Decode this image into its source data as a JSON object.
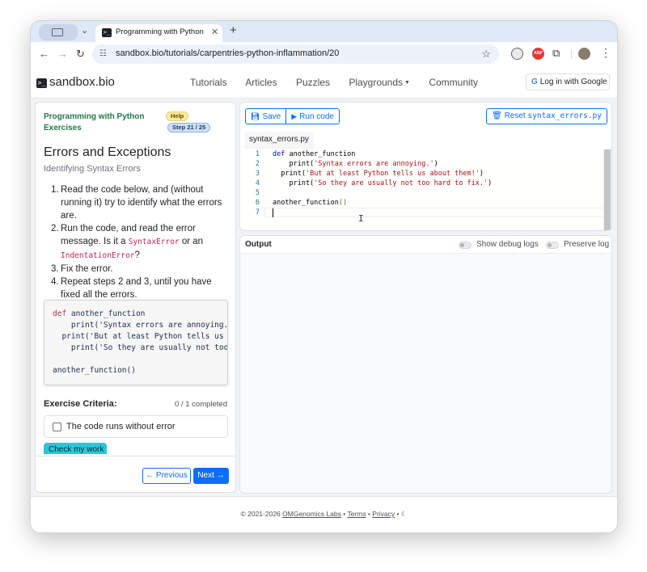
{
  "browser": {
    "tab_title": "Programming with Python Exe",
    "url": "sandbox.bio/tutorials/carpentries-python-inflammation/20",
    "extensions": [
      "google-lens-icon",
      "adblock-icon",
      "puzzle-icon"
    ]
  },
  "site": {
    "brand": "sandbox.bio",
    "nav": {
      "tutorials": "Tutorials",
      "articles": "Articles",
      "puzzles": "Puzzles",
      "playgrounds": "Playgrounds",
      "community": "Community"
    },
    "login": "Log in with Google"
  },
  "tutorial": {
    "course": "Programming with Python Exercises",
    "help_badge": "Help",
    "step_badge": "Step 21 / 25",
    "title": "Errors and Exceptions",
    "subtitle": "Identifying Syntax Errors",
    "steps": {
      "s1_text": "Read the code below, and (without running it) try to identify what the errors are.",
      "s2_pre": "Run the code, and read the error message. Is it a ",
      "s2_code1": "SyntaxError",
      "s2_mid": " or an ",
      "s2_code2": "IndentationError",
      "s2_post": "?",
      "s3_text": "Fix the error.",
      "s4_text": "Repeat steps 2 and 3, until you have fixed all the errors."
    },
    "code_snippet": {
      "l1_kw": "def",
      "l1_rest": " another_function",
      "l2": "    print('Syntax errors are annoying.')",
      "l3": "  print('But at least Python tells us about them!')",
      "l4": "    print('So they are usually not too hard to fix.')",
      "l6": "another_function()"
    },
    "criteria": {
      "title": "Exercise Criteria:",
      "count": "0 / 1 completed",
      "item": "The code runs without error"
    },
    "check_button": "Check my work",
    "prev_button": "← Previous",
    "next_button": "Next →"
  },
  "editor": {
    "save": "Save",
    "run": "Run code",
    "reset_label": "Reset",
    "reset_file": "syntax_errors.py",
    "filename": "syntax_errors.py",
    "line_numbers": [
      "1",
      "2",
      "3",
      "4",
      "5",
      "6",
      "7"
    ],
    "code": {
      "l1_kw": "def",
      "l1_rest": " another_function",
      "l2_pre": "    print(",
      "l2_str": "'Syntax errors are annoying.'",
      "l2_post": ")",
      "l3_pre": "  print(",
      "l3_str": "'But at least Python tells us about them!'",
      "l3_post": ")",
      "l4_pre": "    print(",
      "l4_str": "'So they are usually not too hard to fix.'",
      "l4_post": ")",
      "l6_fn": "another_function",
      "l6_post": "()"
    }
  },
  "output": {
    "title": "Output",
    "debug_label": "Show debug logs",
    "preserve_label": "Preserve log"
  },
  "footer": {
    "copyright": "© 2021-2026 ",
    "company": "OMGenomics Labs",
    "sep": " • ",
    "terms": "Terms",
    "privacy": "Privacy"
  },
  "colors": {
    "primary": "#0d6efd",
    "course_green": "#1f7a4c",
    "check_button": "#2ec5d9"
  }
}
